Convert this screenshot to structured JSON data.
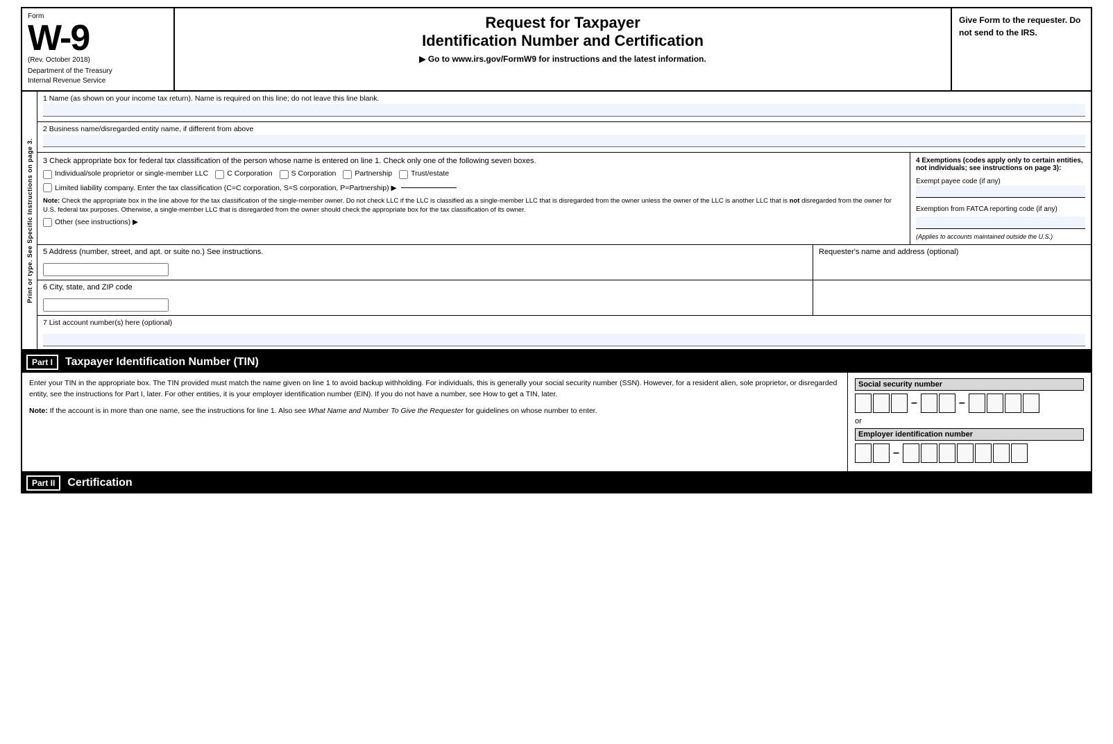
{
  "header": {
    "form_label": "Form",
    "form_number": "W-9",
    "rev_date": "(Rev. October 2018)",
    "department": "Department of the Treasury",
    "irs": "Internal Revenue Service",
    "title_line1": "Request for Taxpayer",
    "title_line2": "Identification Number and Certification",
    "url_line": "▶ Go to www.irs.gov/FormW9 for instructions and the latest information.",
    "give_form": "Give Form to the requester. Do not send to the IRS."
  },
  "fields": {
    "line1_label": "1  Name (as shown on your income tax return). Name is required on this line; do not leave this line blank.",
    "line2_label": "2  Business name/disregarded entity name, if different from above",
    "line3_label": "3  Check appropriate box for federal tax classification of the person whose name is entered on line 1. Check only one of the following seven boxes.",
    "cb_individual_label": "Individual/sole proprietor or single-member LLC",
    "cb_c_corp_label": "C Corporation",
    "cb_s_corp_label": "S Corporation",
    "cb_partnership_label": "Partnership",
    "cb_trust_label": "Trust/estate",
    "llc_label": "Limited liability company. Enter the tax classification (C=C corporation, S=S corporation, P=Partnership) ▶",
    "note_label": "Note:",
    "note_text": " Check the appropriate box in the line above for the tax classification of the single-member owner.  Do not check LLC if the LLC is classified as a single-member LLC that is disregarded from the owner unless the owner of the LLC is another LLC that is ",
    "note_not": "not",
    "note_text2": " disregarded from the owner for U.S. federal tax purposes. Otherwise, a single-member LLC that is disregarded from the owner should check the appropriate box for the tax classification of its owner.",
    "other_label": "Other (see instructions) ▶",
    "line4_label": "4  Exemptions (codes apply only to certain entities, not individuals; see instructions on page 3):",
    "exempt_payee_label": "Exempt payee code (if any)",
    "fatca_label": "Exemption from FATCA reporting code (if any)",
    "fatca_note": "(Applies to accounts maintained outside the U.S.)",
    "line5_label": "5  Address (number, street, and apt. or suite no.) See instructions.",
    "requester_label": "Requester's name and address (optional)",
    "line6_label": "6  City, state, and ZIP code",
    "line7_label": "7  List account number(s) here (optional)",
    "sidebar_text": "Print or type.    See Specific Instructions on page 3."
  },
  "part1": {
    "badge": "Part I",
    "title": "Taxpayer Identification Number (TIN)",
    "body_text": "Enter your TIN in the appropriate box. The TIN provided must match the name given on line 1 to avoid backup withholding. For individuals, this is generally your social security number (SSN). However, for a resident alien, sole proprietor, or disregarded entity, see the instructions for Part I, later. For other entities, it is your employer identification number (EIN). If you do not have a number, see How to get a TIN, later.",
    "note_label": "Note:",
    "note_text": " If the account is in more than one name, see the instructions for line 1. Also see ",
    "note_italic": "What Name and Number To Give the Requester",
    "note_text2": " for guidelines on whose number to enter.",
    "ssn_label": "Social security number",
    "or_label": "or",
    "ein_label": "Employer identification number"
  },
  "part2": {
    "badge": "Part II",
    "title": "Certification"
  }
}
